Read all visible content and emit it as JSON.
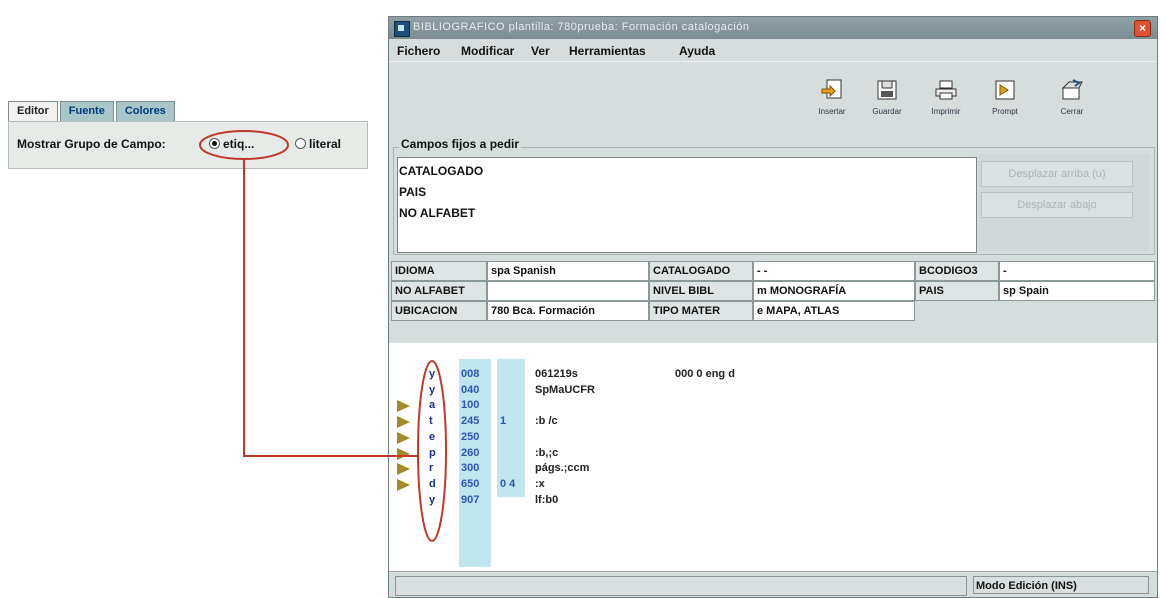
{
  "left_panel": {
    "tabs": [
      "Editor",
      "Fuente",
      "Colores"
    ],
    "label": "Mostrar Grupo de Campo:",
    "options": [
      "etiq...",
      "literal"
    ],
    "selected": "etiq..."
  },
  "window": {
    "title": "BIBLIOGRAFICO plantilla: 780prueba: Formación catalogación",
    "menu": [
      "Fichero",
      "Modificar",
      "Ver",
      "Herramientas",
      "Ayuda"
    ],
    "toolbar": [
      {
        "label": "Insertar",
        "icon": "insert-icon"
      },
      {
        "label": "Guardar",
        "icon": "save-icon"
      },
      {
        "label": "Imprimir",
        "icon": "print-icon"
      },
      {
        "label": "Prompt",
        "icon": "prompt-icon"
      },
      {
        "label": "Cerrar",
        "icon": "close-window-icon"
      }
    ],
    "fixed_group_title": "Campos fijos a pedir",
    "fixed_fields_list": [
      "CATALOGADO",
      "PAIS",
      "NO ALFABET"
    ],
    "move_up_label": "Desplazar arriba (u)",
    "move_down_label": "Desplazar abajo",
    "fields": [
      [
        "IDIOMA",
        "spa  Spanish",
        "CATALOGADO",
        "- -",
        "BCODIGO3",
        "-"
      ],
      [
        "NO ALFABET",
        "",
        "NIVEL BIBL",
        "m  MONOGRAFÍA",
        "PAIS",
        "sp  Spain"
      ],
      [
        "UBICACION",
        "780  Bca. Formación",
        "TIPO MATER",
        "e  MAPA, ATLAS"
      ]
    ],
    "record_lines": [
      {
        "code": "y",
        "tag": "008",
        "ind": "",
        "content": "061219s",
        "extra": "000 0 eng d",
        "arrow": false
      },
      {
        "code": "y",
        "tag": "040",
        "ind": "",
        "content": "SpMaUCFR",
        "arrow": false
      },
      {
        "code": "a",
        "tag": "100",
        "ind": "",
        "content": "",
        "arrow": true
      },
      {
        "code": "t",
        "tag": "245",
        "ind": "1",
        "content": ":b /c",
        "arrow": true
      },
      {
        "code": "e",
        "tag": "250",
        "ind": "",
        "content": "",
        "arrow": true
      },
      {
        "code": "p",
        "tag": "260",
        "ind": "",
        "content": ":b,;c",
        "arrow": true
      },
      {
        "code": "r",
        "tag": "300",
        "ind": "",
        "content": "págs.;ccm",
        "arrow": true
      },
      {
        "code": "d",
        "tag": "650",
        "ind": "0 4",
        "content": ":x",
        "arrow": true
      },
      {
        "code": "y",
        "tag": "907",
        "ind": "",
        "content": "lf:b0",
        "arrow": false
      }
    ],
    "status_mode": "Modo Edición (INS)"
  },
  "colors": {
    "title_bar": "#7b8d93",
    "tab_inactive": "#a9c6c8",
    "annotation": "#c0392b",
    "tag_column": "#bfe6ee",
    "arrow": "#a38a24"
  }
}
